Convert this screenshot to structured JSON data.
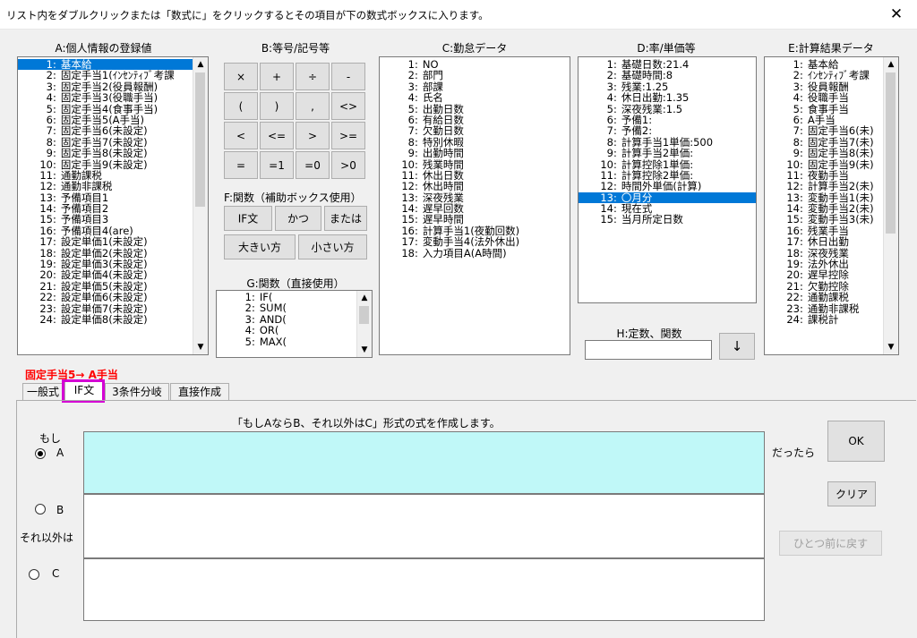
{
  "window": {
    "title": "リスト内をダブルクリックまたは「数式に」をクリックするとその項目が下の数式ボックスに入ります。",
    "close_glyph": "✕"
  },
  "groups": {
    "a": "A:個人情報の登録値",
    "b": "B:等号/記号等",
    "c": "C:勤怠データ",
    "d": "D:率/単価等",
    "e": "E:計算結果データ",
    "f": "F:関数（補助ボックス使用）",
    "g": "G:関数（直接使用）",
    "h": "H:定数、関数"
  },
  "list_a": [
    {
      "n": "1",
      "t": "基本給"
    },
    {
      "n": "2",
      "t": "固定手当1(ｲﾝｾﾝﾃｨﾌﾞ考課"
    },
    {
      "n": "3",
      "t": "固定手当2(役員報酬)"
    },
    {
      "n": "4",
      "t": "固定手当3(役職手当)"
    },
    {
      "n": "5",
      "t": "固定手当4(食事手当)"
    },
    {
      "n": "6",
      "t": "固定手当5(A手当)"
    },
    {
      "n": "7",
      "t": "固定手当6(未設定)"
    },
    {
      "n": "8",
      "t": "固定手当7(未設定)"
    },
    {
      "n": "9",
      "t": "固定手当8(未設定)"
    },
    {
      "n": "10",
      "t": "固定手当9(未設定)"
    },
    {
      "n": "11",
      "t": "通勤課税"
    },
    {
      "n": "12",
      "t": "通勤非課税"
    },
    {
      "n": "13",
      "t": "予備項目1"
    },
    {
      "n": "14",
      "t": "予備項目2"
    },
    {
      "n": "15",
      "t": "予備項目3"
    },
    {
      "n": "16",
      "t": "予備項目4(are)"
    },
    {
      "n": "17",
      "t": "設定単価1(未設定)"
    },
    {
      "n": "18",
      "t": "設定単価2(未設定)"
    },
    {
      "n": "19",
      "t": "設定単価3(未設定)"
    },
    {
      "n": "20",
      "t": "設定単価4(未設定)"
    },
    {
      "n": "21",
      "t": "設定単価5(未設定)"
    },
    {
      "n": "22",
      "t": "設定単価6(未設定)"
    },
    {
      "n": "23",
      "t": "設定単価7(未設定)"
    },
    {
      "n": "24",
      "t": "設定単価8(未設定)"
    }
  ],
  "list_a_selected": 1,
  "operators": [
    "×",
    "+",
    "÷",
    "-",
    "(",
    ")",
    ",",
    "<>",
    "<",
    "<=",
    ">",
    ">=",
    "=",
    "=1",
    "=0",
    ">0"
  ],
  "func_buttons": {
    "if": "IF文",
    "and": "かつ",
    "or": "または",
    "larger": "大きい方",
    "smaller": "小さい方"
  },
  "list_g": [
    {
      "n": "1",
      "t": "IF("
    },
    {
      "n": "2",
      "t": "SUM("
    },
    {
      "n": "3",
      "t": "AND("
    },
    {
      "n": "4",
      "t": "OR("
    },
    {
      "n": "5",
      "t": "MAX("
    }
  ],
  "list_c": [
    {
      "n": "1",
      "t": "NO"
    },
    {
      "n": "2",
      "t": "部門"
    },
    {
      "n": "3",
      "t": "部課"
    },
    {
      "n": "4",
      "t": "氏名"
    },
    {
      "n": "5",
      "t": "出勤日数"
    },
    {
      "n": "6",
      "t": "有給日数"
    },
    {
      "n": "7",
      "t": "欠勤日数"
    },
    {
      "n": "8",
      "t": "特別休暇"
    },
    {
      "n": "9",
      "t": "出勤時間"
    },
    {
      "n": "10",
      "t": "残業時間"
    },
    {
      "n": "11",
      "t": "休出日数"
    },
    {
      "n": "12",
      "t": "休出時間"
    },
    {
      "n": "13",
      "t": "深夜残業"
    },
    {
      "n": "14",
      "t": "遅早回数"
    },
    {
      "n": "15",
      "t": "遅早時間"
    },
    {
      "n": "16",
      "t": "計算手当1(夜勤回数)"
    },
    {
      "n": "17",
      "t": "変動手当4(法外休出)"
    },
    {
      "n": "18",
      "t": "入力項目A(A時間)"
    }
  ],
  "list_d": [
    {
      "n": "1",
      "t": "基礎日数:21.4"
    },
    {
      "n": "2",
      "t": "基礎時間:8"
    },
    {
      "n": "3",
      "t": "残業:1.25"
    },
    {
      "n": "4",
      "t": "休日出勤:1.35"
    },
    {
      "n": "5",
      "t": "深夜残業:1.5"
    },
    {
      "n": "6",
      "t": "予備1:"
    },
    {
      "n": "7",
      "t": "予備2:"
    },
    {
      "n": "8",
      "t": "計算手当1単価:500"
    },
    {
      "n": "9",
      "t": "計算手当2単価:"
    },
    {
      "n": "10",
      "t": "計算控除1単価:"
    },
    {
      "n": "11",
      "t": "計算控除2単価:"
    },
    {
      "n": "12",
      "t": "時間外単価(計算)"
    },
    {
      "n": "13",
      "t": "〇月分"
    },
    {
      "n": "14",
      "t": "現在式"
    },
    {
      "n": "15",
      "t": "当月所定日数"
    }
  ],
  "list_d_selected": 13,
  "list_e": [
    {
      "n": "1",
      "t": "基本給"
    },
    {
      "n": "2",
      "t": "ｲﾝｾﾝﾃｨﾌﾞ考課"
    },
    {
      "n": "3",
      "t": "役員報酬"
    },
    {
      "n": "4",
      "t": "役職手当"
    },
    {
      "n": "5",
      "t": "食事手当"
    },
    {
      "n": "6",
      "t": "A手当"
    },
    {
      "n": "7",
      "t": "固定手当6(未)"
    },
    {
      "n": "8",
      "t": "固定手当7(未)"
    },
    {
      "n": "9",
      "t": "固定手当8(未)"
    },
    {
      "n": "10",
      "t": "固定手当9(未)"
    },
    {
      "n": "11",
      "t": "夜勤手当"
    },
    {
      "n": "12",
      "t": "計算手当2(未)"
    },
    {
      "n": "13",
      "t": "変動手当1(未)"
    },
    {
      "n": "14",
      "t": "変動手当2(未)"
    },
    {
      "n": "15",
      "t": "変動手当3(未)"
    },
    {
      "n": "16",
      "t": "残業手当"
    },
    {
      "n": "17",
      "t": "休日出勤"
    },
    {
      "n": "18",
      "t": "深夜残業"
    },
    {
      "n": "19",
      "t": "法外休出"
    },
    {
      "n": "20",
      "t": "遅早控除"
    },
    {
      "n": "21",
      "t": "欠勤控除"
    },
    {
      "n": "22",
      "t": "通勤課税"
    },
    {
      "n": "23",
      "t": "通勤非課税"
    },
    {
      "n": "24",
      "t": "課税計"
    }
  ],
  "h_input_value": "",
  "h_arrow": "↓",
  "status_text": "固定手当5→ A手当",
  "status_color": "#ff0000",
  "tabs": [
    "一般式",
    "IF文",
    "3条件分岐",
    "直接作成"
  ],
  "active_tab": "IF文",
  "highlight_color": "#d400d4",
  "if_panel": {
    "description": "「もしAならB、それ以外はC」形式の式を作成します。",
    "moshi": "もし",
    "radio_a": "A",
    "radio_b": "B",
    "radio_c": "C",
    "soreigai": "それ以外は",
    "dattara": "だったら",
    "ok": "OK",
    "clear": "クリア",
    "undo": "ひとつ前に戻す",
    "a_value": "",
    "b_value": "",
    "c_value": "",
    "selected": "A",
    "active_box_color": "#c0f8f8"
  }
}
